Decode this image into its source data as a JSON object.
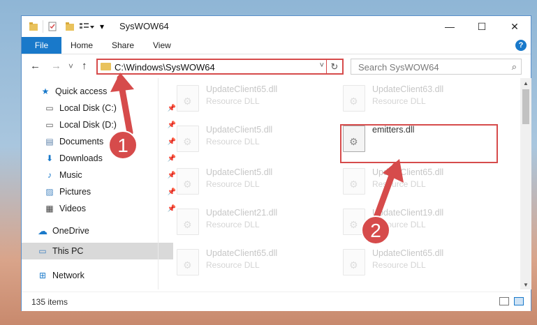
{
  "window": {
    "title": "SysWOW64",
    "controls": {
      "minimize": "—",
      "maximize": "☐",
      "close": "✕"
    }
  },
  "ribbon": {
    "tabs": [
      "File",
      "Home",
      "Share",
      "View"
    ],
    "help": "?"
  },
  "nav": {
    "back": "←",
    "forward": "→",
    "recent": "˅",
    "up": "↑",
    "address": "C:\\Windows\\SysWOW64",
    "dropdown": "˅",
    "refresh": "↻",
    "search_placeholder": "Search SysWOW64",
    "search_icon": "⌕"
  },
  "sidebar": {
    "items": [
      {
        "label": "Quick access",
        "icon": "star-icon",
        "glyph": "★",
        "color": "#1979ca",
        "pinned": false
      },
      {
        "label": "Local Disk (C:)",
        "icon": "drive-icon",
        "glyph": "▭",
        "color": "#555555",
        "pinned": true
      },
      {
        "label": "Local Disk (D:)",
        "icon": "drive-icon",
        "glyph": "▭",
        "color": "#555555",
        "pinned": true
      },
      {
        "label": "Documents",
        "icon": "documents-icon",
        "glyph": "▤",
        "color": "#5a7fa8",
        "pinned": true
      },
      {
        "label": "Downloads",
        "icon": "download-icon",
        "glyph": "⬇",
        "color": "#1979ca",
        "pinned": true
      },
      {
        "label": "Music",
        "icon": "music-icon",
        "glyph": "♪",
        "color": "#1979ca",
        "pinned": true
      },
      {
        "label": "Pictures",
        "icon": "pictures-icon",
        "glyph": "▨",
        "color": "#4a88c2",
        "pinned": true
      },
      {
        "label": "Videos",
        "icon": "videos-icon",
        "glyph": "▦",
        "color": "#444444",
        "pinned": true
      },
      {
        "label": "OneDrive",
        "icon": "cloud-icon",
        "glyph": "☁",
        "color": "#1979ca",
        "pinned": false
      },
      {
        "label": "This PC",
        "icon": "computer-icon",
        "glyph": "▭",
        "color": "#3f7fbf",
        "pinned": false,
        "selected": true
      },
      {
        "label": "Network",
        "icon": "network-icon",
        "glyph": "⊞",
        "color": "#1979ca",
        "pinned": false
      }
    ],
    "pin_glyph": "📌"
  },
  "files": [
    {
      "name": "UpdateClient65.dll",
      "type": "Resource DLL"
    },
    {
      "name": "UpdateClient63.dll",
      "type": "Resource DLL"
    },
    {
      "name": "UpdateClient5.dll",
      "type": "Resource DLL"
    },
    {
      "name": "emitters.dll",
      "type": "",
      "focus": true
    },
    {
      "name": "UpdateClient5.dll",
      "type": "Resource DLL"
    },
    {
      "name": "UpdateClient65.dll",
      "type": "Resource DLL"
    },
    {
      "name": "UpdateClient21.dll",
      "type": "Resource DLL"
    },
    {
      "name": "UpdateClient19.dll",
      "type": "Resource DLL"
    },
    {
      "name": "UpdateClient65.dll",
      "type": "Resource DLL"
    },
    {
      "name": "UpdateClient65.dll",
      "type": "Resource DLL"
    }
  ],
  "status": {
    "item_count": "135 items"
  },
  "callouts": [
    "1",
    "2"
  ],
  "colors": {
    "accent": "#1979ca",
    "highlight": "#d64b4b"
  }
}
